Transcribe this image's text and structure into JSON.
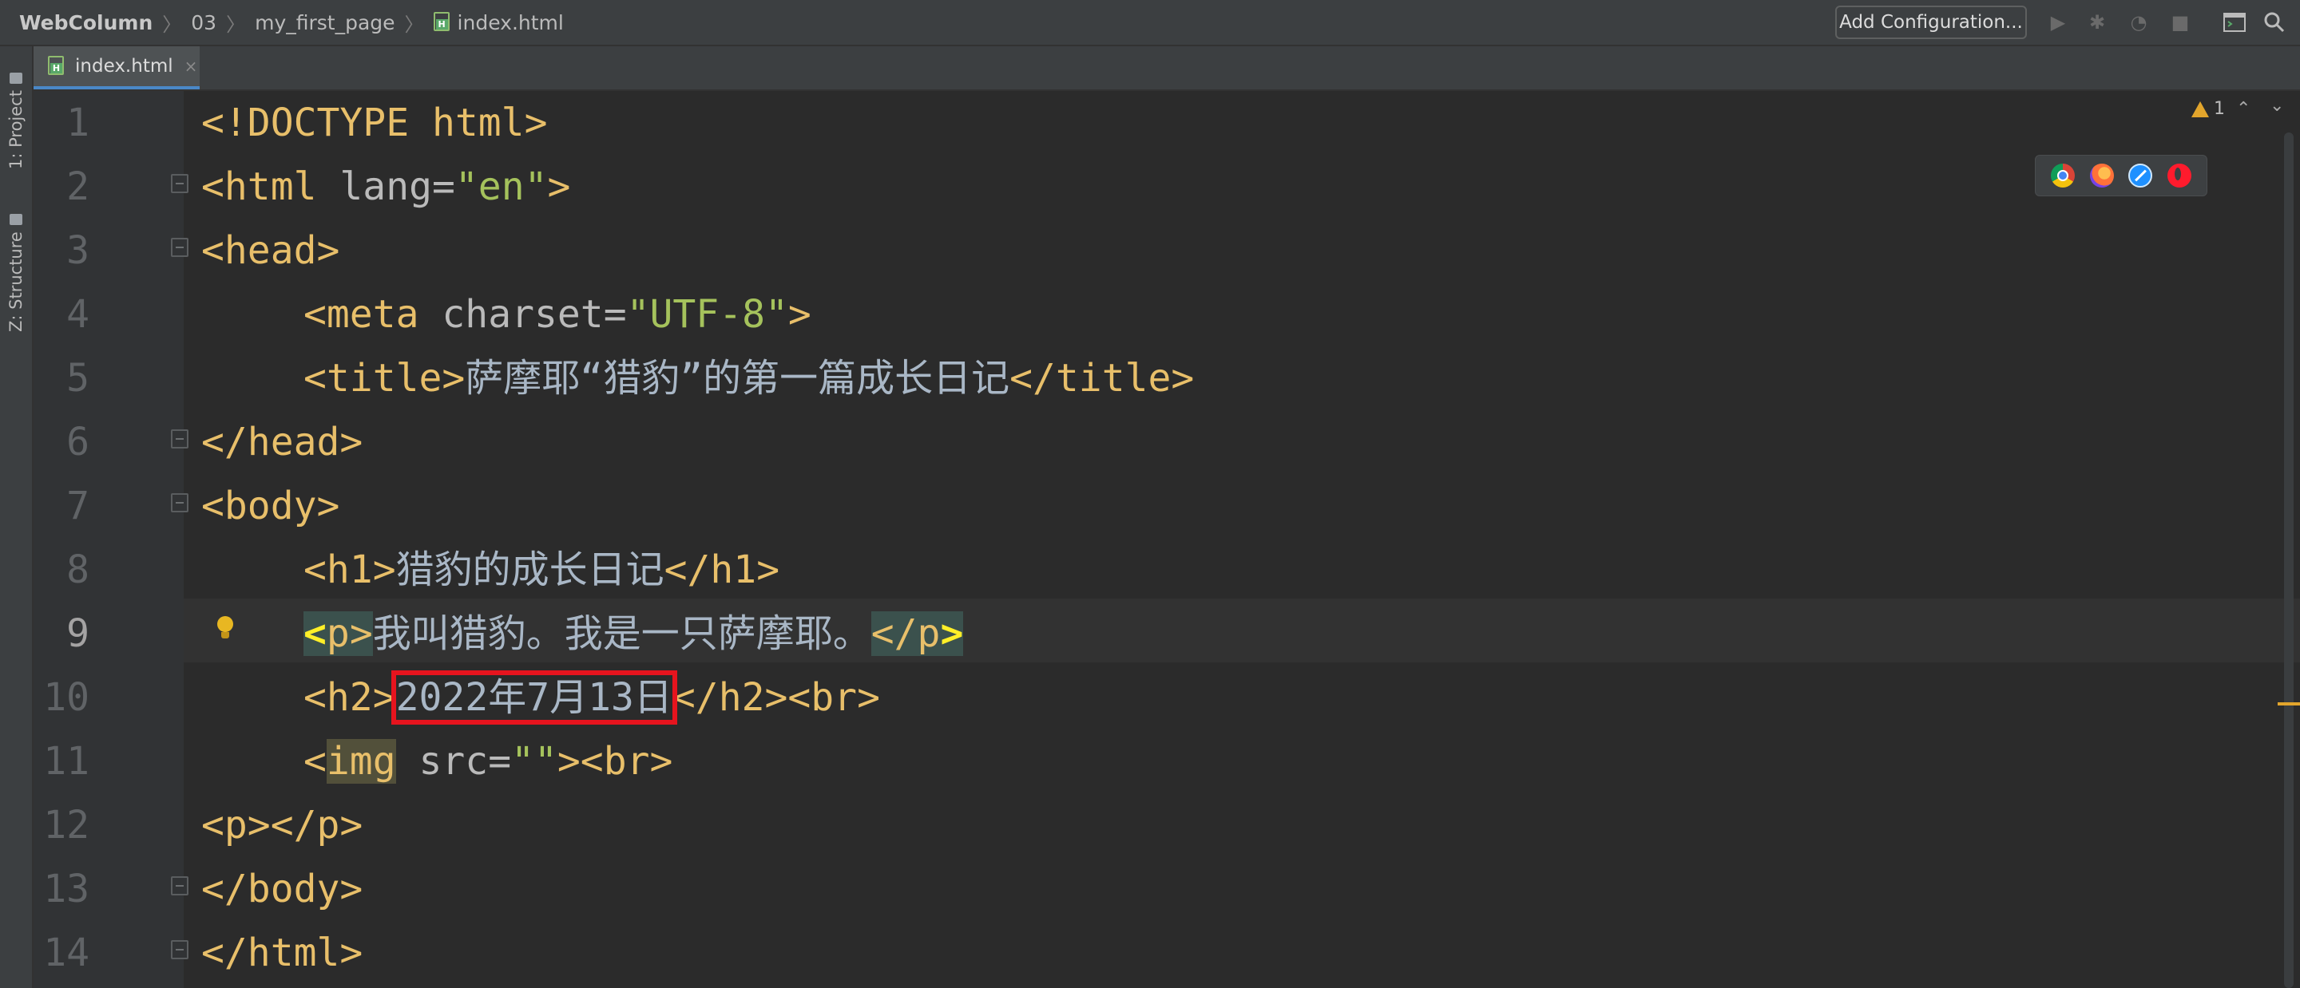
{
  "breadcrumb": {
    "project": "WebColumn",
    "folder": "03",
    "subfolder": "my_first_page",
    "file": "index.html"
  },
  "toolbar": {
    "add_configuration": "Add Configuration..."
  },
  "left_panel": {
    "project_tab": "1: Project",
    "structure_tab": "Z: Structure"
  },
  "editor_tab": {
    "label": "index.html",
    "close": "×"
  },
  "inspection": {
    "warning_count": "1"
  },
  "editor": {
    "current_line": 9,
    "line_numbers": [
      "1",
      "2",
      "3",
      "4",
      "5",
      "6",
      "7",
      "8",
      "9",
      "10",
      "11",
      "12",
      "13",
      "14"
    ],
    "code": {
      "l1": "<!DOCTYPE html>",
      "l2_tag_open": "<html ",
      "l2_attr": "lang",
      "l2_eq": "=",
      "l2_val": "\"en\"",
      "l2_tag_close": ">",
      "l3": "<head>",
      "l4_tag_open": "<meta ",
      "l4_attr": "charset",
      "l4_eq": "=",
      "l4_val": "\"UTF-8\"",
      "l4_tag_close": ">",
      "l5_open": "<title>",
      "l5_text": "萨摩耶“猎豹”的第一篇成长日记",
      "l5_close": "</title>",
      "l6": "</head>",
      "l7": "<body>",
      "l8_open": "<h1>",
      "l8_text": "猎豹的成长日记",
      "l8_close": "</h1>",
      "l9_lt": "<",
      "l9_p": "p",
      "l9_gt": ">",
      "l9_text": "我叫猎豹。我是一只萨摩耶。",
      "l9_close_lt": "</",
      "l9_close_p": "p",
      "l9_close_gt": ">",
      "l10_open": "<h2>",
      "l10_text": "2022年7月13日",
      "l10_close": "</h2><br>",
      "l11_lt": "<",
      "l11_img": "img",
      "l11_attr": " src",
      "l11_eq": "=",
      "l11_val": "\"\"",
      "l11_close": "><br>",
      "l12": "<p></p>",
      "l13": "</body>",
      "l14": "</html>"
    }
  }
}
